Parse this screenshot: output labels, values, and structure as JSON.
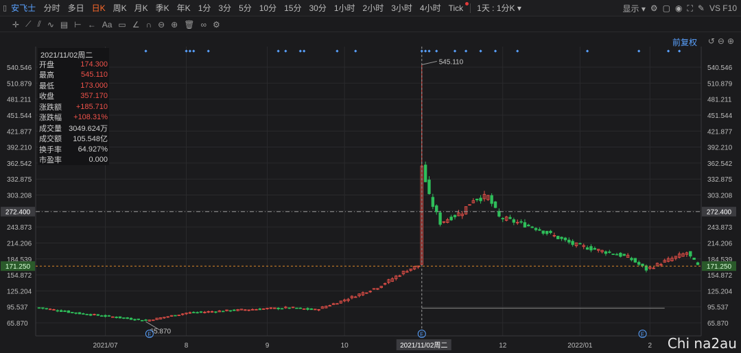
{
  "topbar": {
    "stock_name": "安飞士",
    "periods": [
      "分时",
      "多日",
      "日K",
      "周K",
      "月K",
      "季K",
      "年K",
      "1分",
      "3分",
      "5分",
      "10分",
      "15分",
      "30分",
      "1小时",
      "2小时",
      "3小时",
      "4小时",
      "Tick"
    ],
    "active_period": "日K",
    "interval_select": "1天 : 1分K",
    "display_label": "显示",
    "vs_label": "VS F10"
  },
  "toolbar2": {
    "text_tool": "Aa"
  },
  "price_adjust": "前复权",
  "info_panel": {
    "date": "2021/11/02周二",
    "rows": [
      {
        "label": "开盘",
        "value": "174.300",
        "up": true
      },
      {
        "label": "最高",
        "value": "545.110",
        "up": true
      },
      {
        "label": "最低",
        "value": "173.000",
        "up": true
      },
      {
        "label": "收盘",
        "value": "357.170",
        "up": true
      },
      {
        "label": "涨跌额",
        "value": "+185.710",
        "up": true
      },
      {
        "label": "涨跌幅",
        "value": "+108.31%",
        "up": true
      },
      {
        "label": "成交量",
        "value": "3049.624万",
        "up": false
      },
      {
        "label": "成交额",
        "value": "105.548亿",
        "up": false
      },
      {
        "label": "换手率",
        "value": "64.927%",
        "up": false
      },
      {
        "label": "市盈率",
        "value": "0.000",
        "up": false
      }
    ]
  },
  "watermark": "Chi na2au",
  "colors": {
    "up": "#f0524a",
    "down": "#2fbe5a",
    "grid": "#2a2a2d",
    "axis_text": "#bdbdbd",
    "accent": "#5aa2ff"
  },
  "chart_data": {
    "type": "candlestick",
    "y_ticks": [
      65.87,
      95.537,
      125.204,
      154.872,
      184.539,
      214.206,
      243.873,
      273.541,
      303.208,
      332.875,
      362.542,
      392.21,
      421.877,
      451.544,
      481.211,
      510.879,
      540.546
    ],
    "ylim": [
      50,
      560
    ],
    "x_labels": [
      {
        "label": "2021/07",
        "idx": 18
      },
      {
        "label": "8",
        "idx": 40
      },
      {
        "label": "9",
        "idx": 62
      },
      {
        "label": "10",
        "idx": 83
      },
      {
        "label": "11",
        "idx": 104
      },
      {
        "label": "12",
        "idx": 126
      },
      {
        "label": "2022/01",
        "idx": 147
      },
      {
        "label": "2",
        "idx": 166
      }
    ],
    "cursor_label": "2021/11/02周二",
    "cursor_idx": 104,
    "hline_price": 272.4,
    "hline_label": "272.400",
    "last_price": 171.25,
    "last_label": "171.250",
    "max_label": "545.110",
    "min_label": "65.870",
    "min_idx": 29,
    "bottom_line_price": 93,
    "event_marks": [
      30,
      104,
      164
    ],
    "event_glyph": "E",
    "top_dots": [
      29,
      40,
      41,
      42,
      46,
      65,
      67,
      71,
      72,
      81,
      86,
      104,
      105,
      106,
      108,
      113,
      116,
      120,
      124,
      130,
      149,
      163,
      171,
      174
    ]
  }
}
